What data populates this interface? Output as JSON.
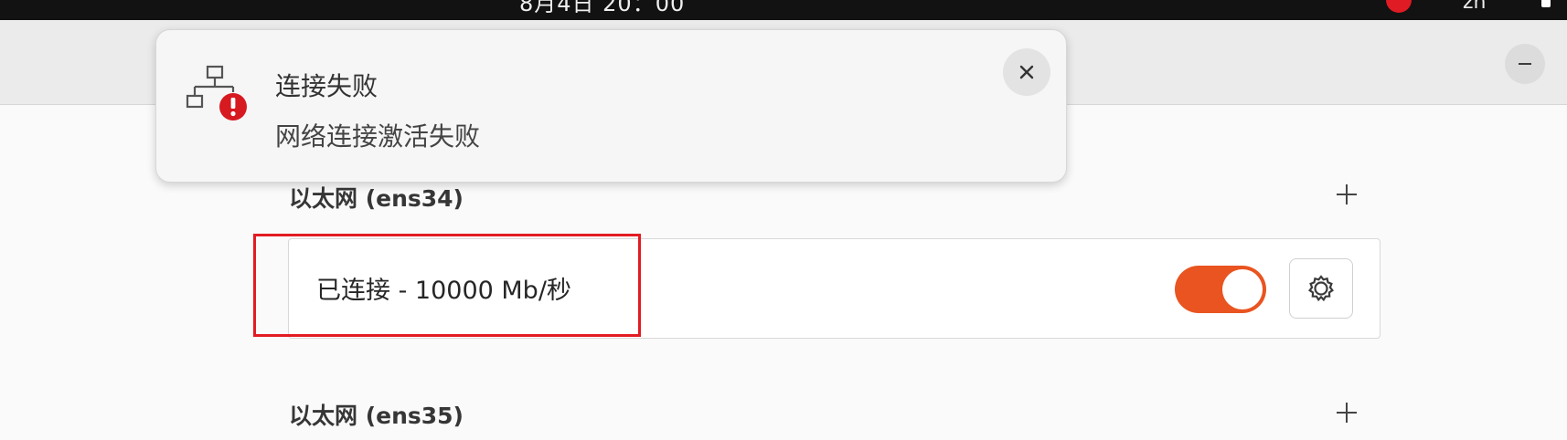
{
  "topbar": {
    "clock": "8月4日 20：00",
    "language_indicator": "zh"
  },
  "window": {
    "minimize_icon": "minimize-icon"
  },
  "notification": {
    "icon": "network-error-icon",
    "title": "连接失败",
    "body": "网络连接激活失败",
    "close_icon": "close-icon"
  },
  "sections": [
    {
      "title": "以太网 (ens34)",
      "connection": {
        "status": "已连接 - 10000 Mb/秒",
        "enabled": true,
        "settings_icon": "gear-icon"
      }
    },
    {
      "title": "以太网 (ens35)"
    }
  ],
  "colors": {
    "accent": "#e95420",
    "highlight": "#e31b23",
    "error": "#d71920"
  }
}
